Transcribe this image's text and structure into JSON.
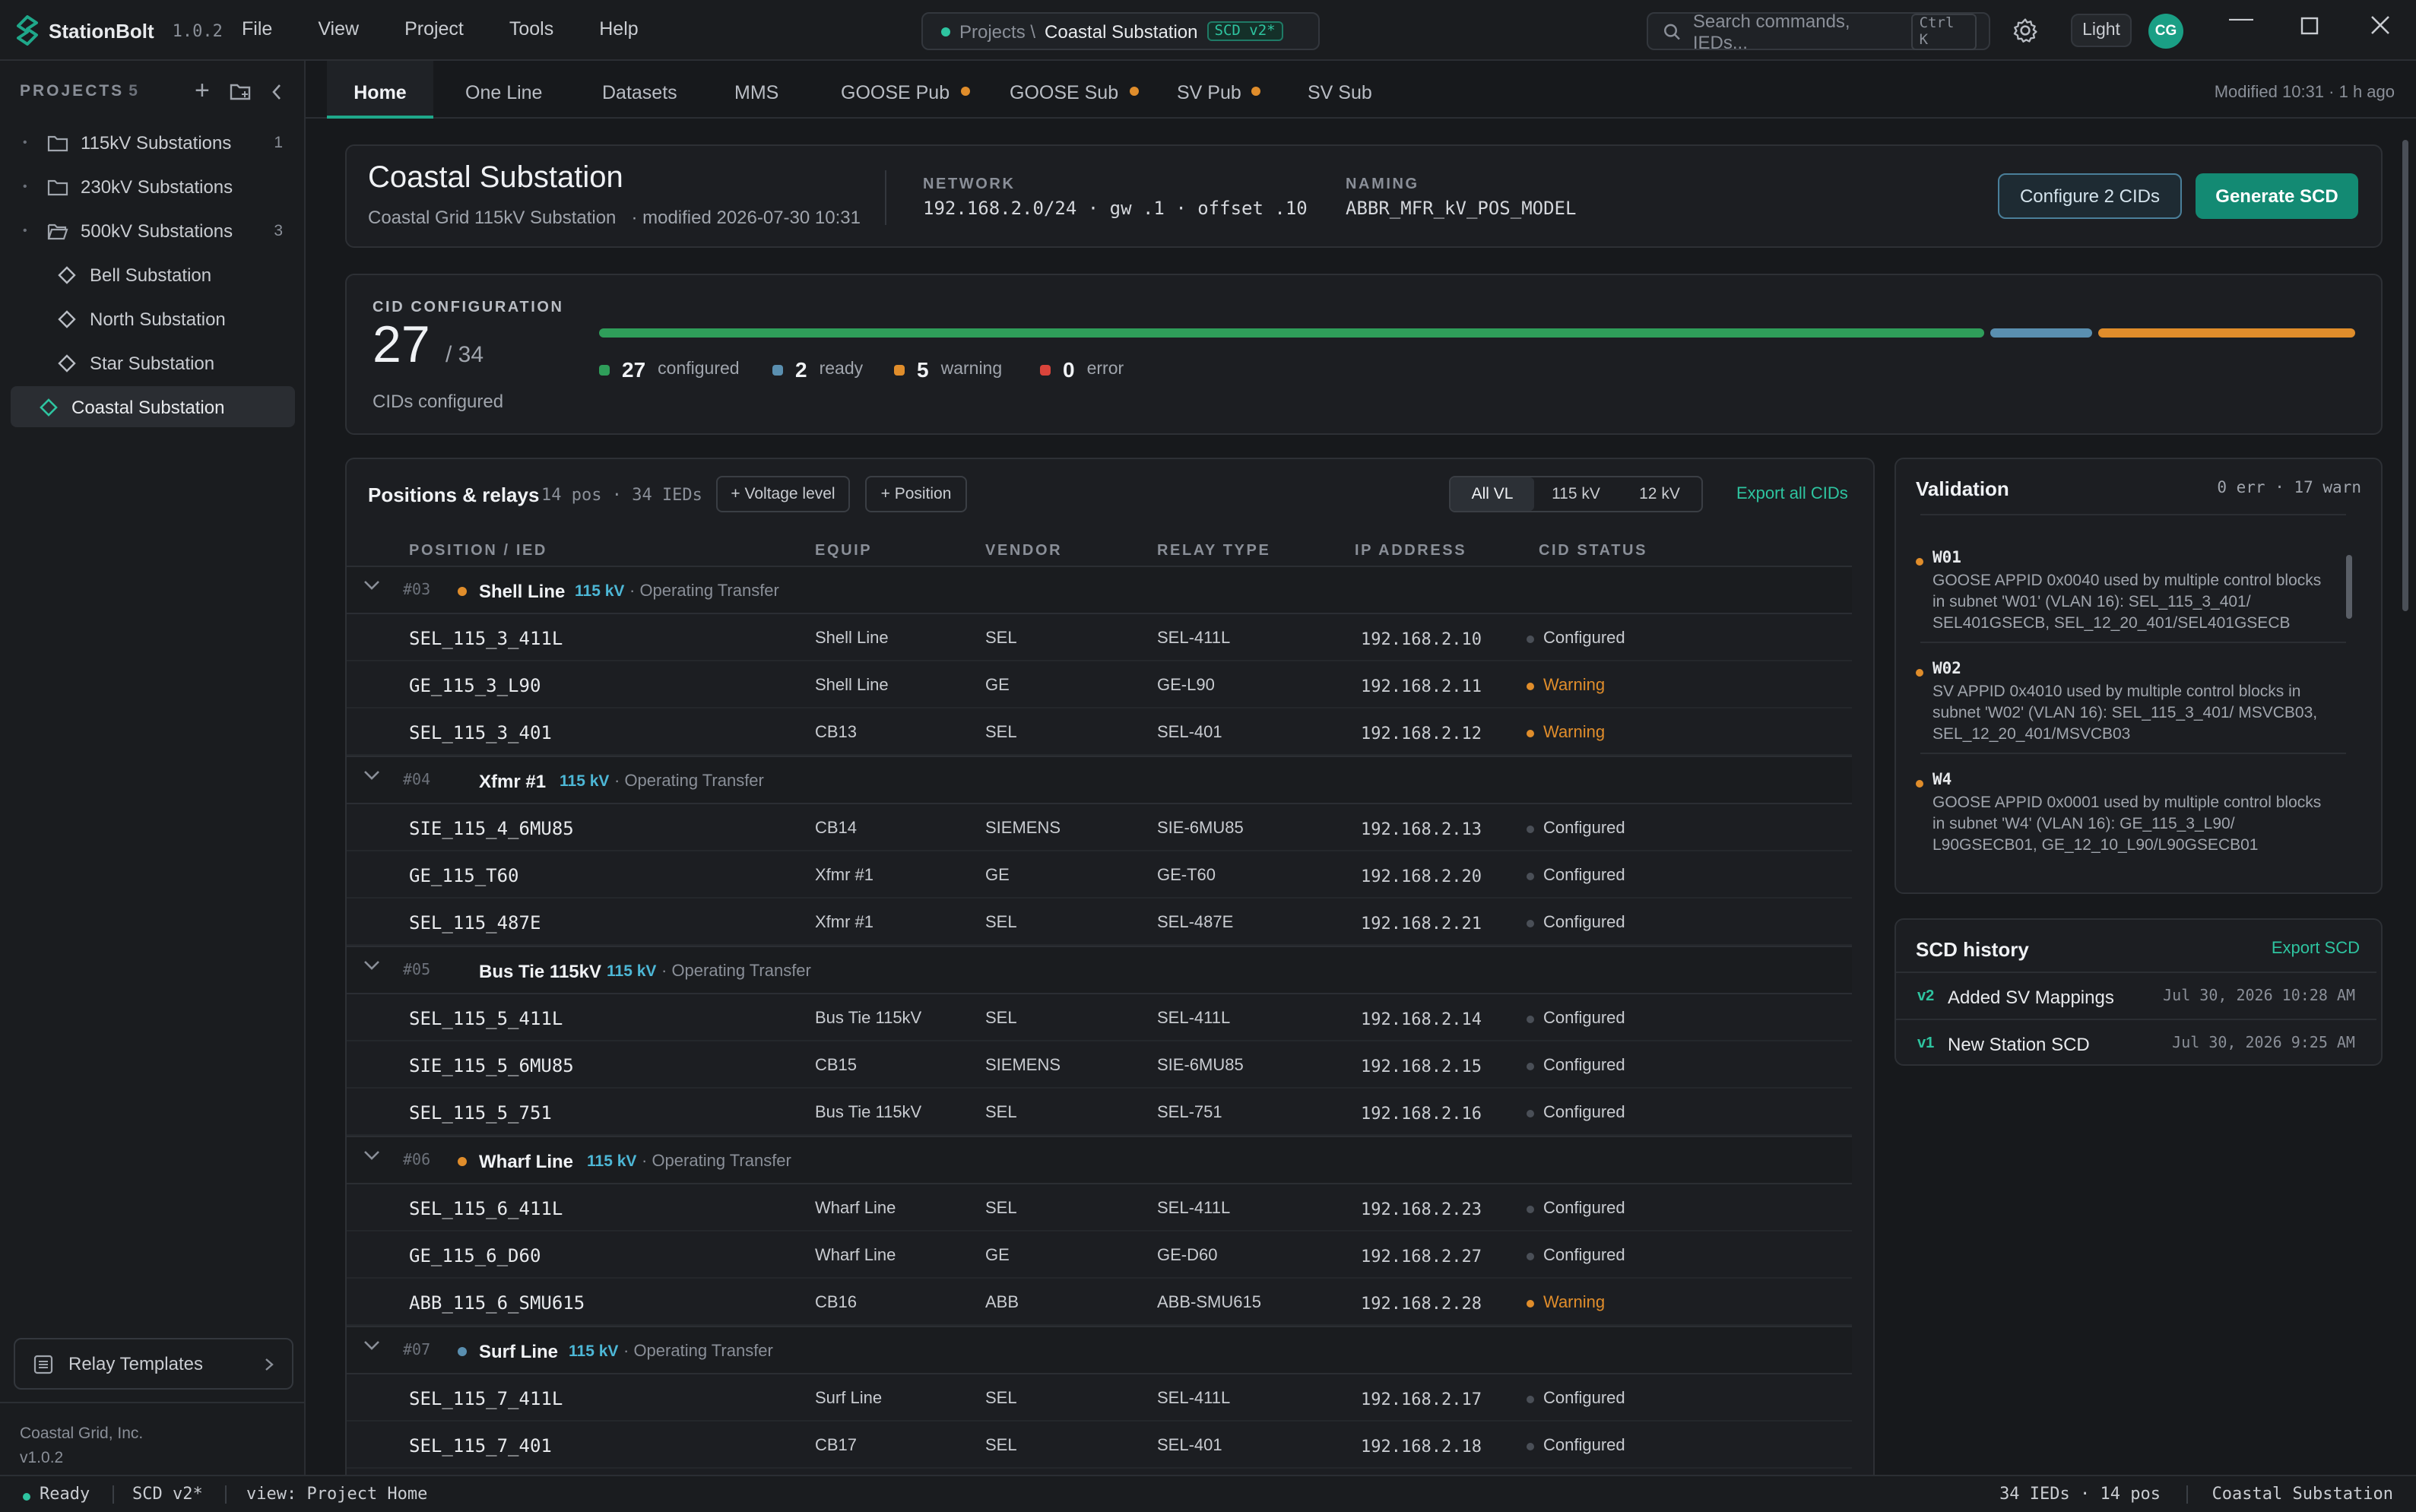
{
  "app": {
    "name": "StationBolt",
    "version": "1.0.2"
  },
  "menu": [
    "File",
    "View",
    "Project",
    "Tools",
    "Help"
  ],
  "breadcrumb": {
    "root": "Projects \\",
    "current": "Coastal Substation",
    "badge": "SCD v2*"
  },
  "search": {
    "placeholder": "Search commands, IEDs...",
    "shortcut": "Ctrl K"
  },
  "theme_button": "Light",
  "user_initials": "CG",
  "colors": {
    "accent": "#1fa88a",
    "configured": "#2f9e5a",
    "ready": "#5a8fb0",
    "warning": "#e08d2b",
    "error": "#d9443b"
  },
  "sidebar": {
    "header": "PROJECTS",
    "count": "5",
    "items": [
      {
        "label": "115kV Substations",
        "count": "1",
        "type": "folder"
      },
      {
        "label": "230kV Substations",
        "count": "",
        "type": "folder"
      },
      {
        "label": "500kV Substations",
        "count": "3",
        "type": "folder-open"
      },
      {
        "label": "Bell Substation",
        "count": "",
        "type": "station"
      },
      {
        "label": "North Substation",
        "count": "",
        "type": "station"
      },
      {
        "label": "Star Substation",
        "count": "",
        "type": "station"
      },
      {
        "label": "Coastal Substation",
        "count": "",
        "type": "station-active"
      }
    ],
    "relay_templates": "Relay Templates",
    "company": "Coastal Grid, Inc.",
    "version": "v1.0.2"
  },
  "tabs": [
    {
      "label": "Home",
      "active": true,
      "dot": false
    },
    {
      "label": "One Line",
      "dot": false
    },
    {
      "label": "Datasets",
      "dot": false
    },
    {
      "label": "MMS",
      "dot": false
    },
    {
      "label": "GOOSE Pub",
      "dot": true
    },
    {
      "label": "GOOSE Sub",
      "dot": true
    },
    {
      "label": "SV Pub",
      "dot": true
    },
    {
      "label": "SV Sub",
      "dot": false
    }
  ],
  "modified_info": "Modified 10:31 · 1 h ago",
  "header": {
    "title": "Coastal Substation",
    "subtitle": "Coastal Grid 115kV Substation",
    "modified": "· modified 2026-07-30 10:31",
    "network_label": "NETWORK",
    "network_value": "192.168.2.0/24 · gw .1 · offset .10",
    "naming_label": "NAMING",
    "naming_value": "ABBR_MFR_kV_POS_MODEL",
    "configure_button": "Configure 2 CIDs",
    "generate_button": "Generate SCD"
  },
  "cid": {
    "label": "CID CONFIGURATION",
    "configured": 27,
    "total_text": "/ 34",
    "caption": "CIDs configured",
    "legend": [
      {
        "count": "27",
        "label": "configured",
        "color": "#2f9e5a"
      },
      {
        "count": "2",
        "label": "ready",
        "color": "#5a8fb0"
      },
      {
        "count": "5",
        "label": "warning",
        "color": "#e08d2b"
      },
      {
        "count": "0",
        "label": "error",
        "color": "#d9443b"
      }
    ],
    "segments": [
      {
        "fraction": 0.794,
        "color": "#2f9e5a"
      },
      {
        "fraction": 0.059,
        "color": "#5a8fb0"
      },
      {
        "fraction": 0.147,
        "color": "#e08d2b"
      }
    ]
  },
  "positions": {
    "title": "Positions & relays",
    "meta": "14 pos · 34 IEDs",
    "add_voltage": "+ Voltage level",
    "add_position": "+ Position",
    "filters": [
      "All VL",
      "115 kV",
      "12 kV"
    ],
    "export": "Export all CIDs",
    "columns": [
      "POSITION / IED",
      "EQUIP",
      "VENDOR",
      "RELAY TYPE",
      "IP ADDRESS",
      "CID STATUS"
    ],
    "groups": [
      {
        "num": "#03",
        "name": "Shell Line",
        "vl": "115 kV",
        "desc": "· Operating Transfer",
        "dot": "#e08d2b",
        "ieds": [
          {
            "name": "SEL_115_3_411L",
            "equip": "Shell Line",
            "vendor": "SEL",
            "relay": "SEL-411L",
            "ip": "192.168.2.10",
            "status": "Configured"
          },
          {
            "name": "GE_115_3_L90",
            "equip": "Shell Line",
            "vendor": "GE",
            "relay": "GE-L90",
            "ip": "192.168.2.11",
            "status": "Warning"
          },
          {
            "name": "SEL_115_3_401",
            "equip": "CB13",
            "vendor": "SEL",
            "relay": "SEL-401",
            "ip": "192.168.2.12",
            "status": "Warning"
          }
        ]
      },
      {
        "num": "#04",
        "name": "Xfmr #1",
        "vl": "115 kV",
        "desc": "· Operating Transfer",
        "dot": "",
        "ieds": [
          {
            "name": "SIE_115_4_6MU85",
            "equip": "CB14",
            "vendor": "SIEMENS",
            "relay": "SIE-6MU85",
            "ip": "192.168.2.13",
            "status": "Configured"
          },
          {
            "name": "GE_115_T60",
            "equip": "Xfmr #1",
            "vendor": "GE",
            "relay": "GE-T60",
            "ip": "192.168.2.20",
            "status": "Configured"
          },
          {
            "name": "SEL_115_487E",
            "equip": "Xfmr #1",
            "vendor": "SEL",
            "relay": "SEL-487E",
            "ip": "192.168.2.21",
            "status": "Configured"
          }
        ]
      },
      {
        "num": "#05",
        "name": "Bus Tie 115kV",
        "vl": "115 kV",
        "desc": "· Operating Transfer",
        "dot": "",
        "ieds": [
          {
            "name": "SEL_115_5_411L",
            "equip": "Bus Tie 115kV",
            "vendor": "SEL",
            "relay": "SEL-411L",
            "ip": "192.168.2.14",
            "status": "Configured"
          },
          {
            "name": "SIE_115_5_6MU85",
            "equip": "CB15",
            "vendor": "SIEMENS",
            "relay": "SIE-6MU85",
            "ip": "192.168.2.15",
            "status": "Configured"
          },
          {
            "name": "SEL_115_5_751",
            "equip": "Bus Tie 115kV",
            "vendor": "SEL",
            "relay": "SEL-751",
            "ip": "192.168.2.16",
            "status": "Configured"
          }
        ]
      },
      {
        "num": "#06",
        "name": "Wharf Line",
        "vl": "115 kV",
        "desc": "· Operating Transfer",
        "dot": "#e08d2b",
        "ieds": [
          {
            "name": "SEL_115_6_411L",
            "equip": "Wharf Line",
            "vendor": "SEL",
            "relay": "SEL-411L",
            "ip": "192.168.2.23",
            "status": "Configured"
          },
          {
            "name": "GE_115_6_D60",
            "equip": "Wharf Line",
            "vendor": "GE",
            "relay": "GE-D60",
            "ip": "192.168.2.27",
            "status": "Configured"
          },
          {
            "name": "ABB_115_6_SMU615",
            "equip": "CB16",
            "vendor": "ABB",
            "relay": "ABB-SMU615",
            "ip": "192.168.2.28",
            "status": "Warning"
          }
        ]
      },
      {
        "num": "#07",
        "name": "Surf Line",
        "vl": "115 kV",
        "desc": "· Operating Transfer",
        "dot": "#5a8fb0",
        "ieds": [
          {
            "name": "SEL_115_7_411L",
            "equip": "Surf Line",
            "vendor": "SEL",
            "relay": "SEL-411L",
            "ip": "192.168.2.17",
            "status": "Configured"
          },
          {
            "name": "SEL_115_7_401",
            "equip": "CB17",
            "vendor": "SEL",
            "relay": "SEL-401",
            "ip": "192.168.2.18",
            "status": "Configured"
          }
        ]
      }
    ]
  },
  "validation": {
    "title": "Validation",
    "count": "0 err · 17 warn",
    "items": [
      {
        "code": "W01",
        "msg": "GOOSE APPID 0x0040 used by multiple control blocks in subnet 'W01' (VLAN 16): SEL_115_3_401/ SEL401GSECB, SEL_12_20_401/SEL401GSECB"
      },
      {
        "code": "W02",
        "msg": "SV APPID 0x4010 used by multiple control blocks in subnet 'W02' (VLAN 16): SEL_115_3_401/ MSVCB03, SEL_12_20_401/MSVCB03"
      },
      {
        "code": "W4",
        "msg": "GOOSE APPID 0x0001 used by multiple control blocks in subnet 'W4' (VLAN 16): GE_115_3_L90/ L90GSECB01, GE_12_10_L90/L90GSECB01"
      }
    ]
  },
  "scd_history": {
    "title": "SCD history",
    "export": "Export SCD",
    "items": [
      {
        "ver": "v2",
        "name": "Added SV Mappings",
        "date": "Jul 30, 2026 10:28 AM"
      },
      {
        "ver": "v1",
        "name": "New Station SCD",
        "date": "Jul 30, 2026 9:25 AM"
      }
    ]
  },
  "status": {
    "ready": "Ready",
    "scd": "SCD v2*",
    "view": "view: Project Home",
    "counts": "34 IEDs · 14 pos",
    "project": "Coastal Substation"
  }
}
